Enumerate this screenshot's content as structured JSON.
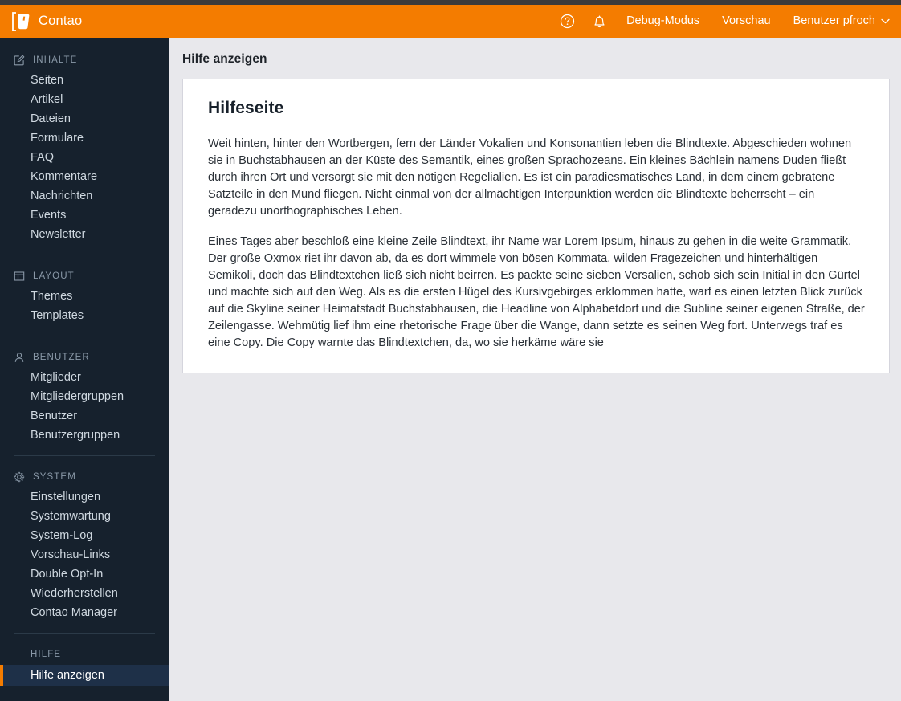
{
  "header": {
    "brand": "Contao",
    "help_icon": "question-circle-icon",
    "notifications_icon": "bell-icon",
    "debug_label": "Debug-Modus",
    "preview_label": "Vorschau",
    "user_label": "Benutzer pfroch",
    "chevron_icon": "chevron-down-icon",
    "accent_color": "#f47c00"
  },
  "sidebar": {
    "background_color": "#16212d",
    "active_marker_color": "#f47c00",
    "groups": [
      {
        "label": "INHALTE",
        "icon": "edit-square-icon",
        "items": [
          {
            "label": "Seiten",
            "active": false
          },
          {
            "label": "Artikel",
            "active": false
          },
          {
            "label": "Dateien",
            "active": false
          },
          {
            "label": "Formulare",
            "active": false
          },
          {
            "label": "FAQ",
            "active": false
          },
          {
            "label": "Kommentare",
            "active": false
          },
          {
            "label": "Nachrichten",
            "active": false
          },
          {
            "label": "Events",
            "active": false
          },
          {
            "label": "Newsletter",
            "active": false
          }
        ]
      },
      {
        "label": "LAYOUT",
        "icon": "layout-grid-icon",
        "items": [
          {
            "label": "Themes",
            "active": false
          },
          {
            "label": "Templates",
            "active": false
          }
        ]
      },
      {
        "label": "BENUTZER",
        "icon": "person-icon",
        "items": [
          {
            "label": "Mitglieder",
            "active": false
          },
          {
            "label": "Mitgliedergruppen",
            "active": false
          },
          {
            "label": "Benutzer",
            "active": false
          },
          {
            "label": "Benutzergruppen",
            "active": false
          }
        ]
      },
      {
        "label": "SYSTEM",
        "icon": "gear-icon",
        "items": [
          {
            "label": "Einstellungen",
            "active": false
          },
          {
            "label": "Systemwartung",
            "active": false
          },
          {
            "label": "System-Log",
            "active": false
          },
          {
            "label": "Vorschau-Links",
            "active": false
          },
          {
            "label": "Double Opt-In",
            "active": false
          },
          {
            "label": "Wiederherstellen",
            "active": false
          },
          {
            "label": "Contao Manager",
            "active": false
          }
        ]
      },
      {
        "label": "HILFE",
        "icon": "",
        "items": [
          {
            "label": "Hilfe anzeigen",
            "active": true
          }
        ]
      }
    ]
  },
  "main": {
    "page_title": "Hilfe anzeigen",
    "card": {
      "heading": "Hilfeseite",
      "paragraphs": [
        "Weit hinten, hinter den Wortbergen, fern der Länder Vokalien und Konsonantien leben die Blindtexte. Abgeschieden wohnen sie in Buchstabhausen an der Küste des Semantik, eines großen Sprachozeans. Ein kleines Bächlein namens Duden fließt durch ihren Ort und versorgt sie mit den nötigen Regelialien. Es ist ein paradiesmatisches Land, in dem einem gebratene Satzteile in den Mund fliegen. Nicht einmal von der allmächtigen Interpunktion werden die Blindtexte beherrscht – ein geradezu unorthographisches Leben.",
        "Eines Tages aber beschloß eine kleine Zeile Blindtext, ihr Name war Lorem Ipsum, hinaus zu gehen in die weite Grammatik. Der große Oxmox riet ihr davon ab, da es dort wimmele von bösen Kommata, wilden Fragezeichen und hinterhältigen Semikoli, doch das Blindtextchen ließ sich nicht beirren. Es packte seine sieben Versalien, schob sich sein Initial in den Gürtel und machte sich auf den Weg. Als es die ersten Hügel des Kursivgebirges erklommen hatte, warf es einen letzten Blick zurück auf die Skyline seiner Heimatstadt Buchstabhausen, die Headline von Alphabetdorf und die Subline seiner eigenen Straße, der Zeilengasse. Wehmütig lief ihm eine rhetorische Frage über die Wange, dann setzte es seinen Weg fort. Unterwegs traf es eine Copy. Die Copy warnte das Blindtextchen, da, wo sie herkäme wäre sie"
      ]
    }
  }
}
